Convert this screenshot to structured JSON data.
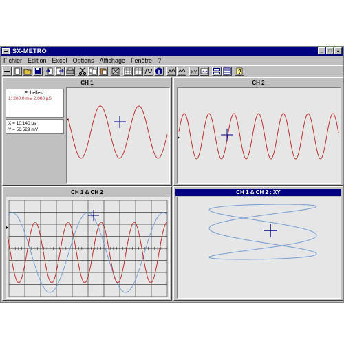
{
  "window": {
    "title": "SX-METRO",
    "buttons": [
      "_",
      "□",
      "×"
    ]
  },
  "menu": [
    "Fichier",
    "Edition",
    "Excel",
    "Options",
    "Affichage",
    "Fenêtre",
    "?"
  ],
  "toolbar_icons": [
    "minus-icon",
    "new-icon",
    "open-icon",
    "save-icon",
    "import-icon",
    "export-icon",
    "print-icon",
    "cut-icon",
    "copy-icon",
    "paste-icon",
    "zoom-icon",
    "grid-icon",
    "table-icon",
    "curve-icon",
    "info-icon",
    "wave-a-icon",
    "wave-b-icon",
    "xy-icon",
    "photo-icon",
    "tile-h-icon",
    "tile-v-icon",
    "help-icon"
  ],
  "panes": {
    "ch1": {
      "title": "CH 1"
    },
    "ch2": {
      "title": "CH 2"
    },
    "ch1ch2": {
      "title": "CH 1 & CH 2"
    },
    "xy": {
      "title": "CH 1 & CH 2 : XY"
    }
  },
  "scales": {
    "heading": "Echelles :",
    "ch1_line": "1: 200.0 mV   2.000 µS"
  },
  "cursor": {
    "x": "X = 10.140 µs",
    "y": "Y = 56.529 mV"
  },
  "colors": {
    "ch1": "#c03030",
    "ch2": "#7aa0d0",
    "titlebar": "#000080",
    "cursor": "#000080"
  }
}
